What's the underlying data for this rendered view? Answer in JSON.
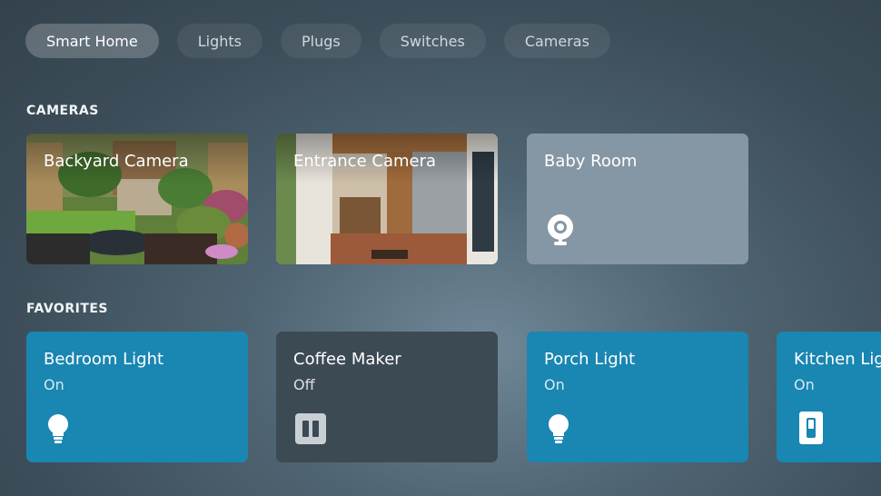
{
  "tabs": [
    {
      "label": "Smart Home",
      "active": true
    },
    {
      "label": "Lights",
      "active": false
    },
    {
      "label": "Plugs",
      "active": false
    },
    {
      "label": "Switches",
      "active": false
    },
    {
      "label": "Cameras",
      "active": false
    }
  ],
  "cameras": {
    "heading": "CAMERAS",
    "items": [
      {
        "name": "Backyard Camera",
        "kind": "image"
      },
      {
        "name": "Entrance Camera",
        "kind": "image"
      },
      {
        "name": "Baby Room",
        "kind": "icon",
        "icon": "webcam-icon"
      }
    ]
  },
  "favorites": {
    "heading": "FAVORITES",
    "items": [
      {
        "name": "Bedroom Light",
        "state": "On",
        "icon": "bulb-icon",
        "color": "#1a86b2"
      },
      {
        "name": "Coffee Maker",
        "state": "Off",
        "icon": "plug-icon",
        "color": "#3c4a54"
      },
      {
        "name": "Porch Light",
        "state": "On",
        "icon": "bulb-icon",
        "color": "#1a86b2"
      },
      {
        "name": "Kitchen Light",
        "state": "On",
        "icon": "switch-icon",
        "color": "#1a86b2"
      }
    ]
  }
}
